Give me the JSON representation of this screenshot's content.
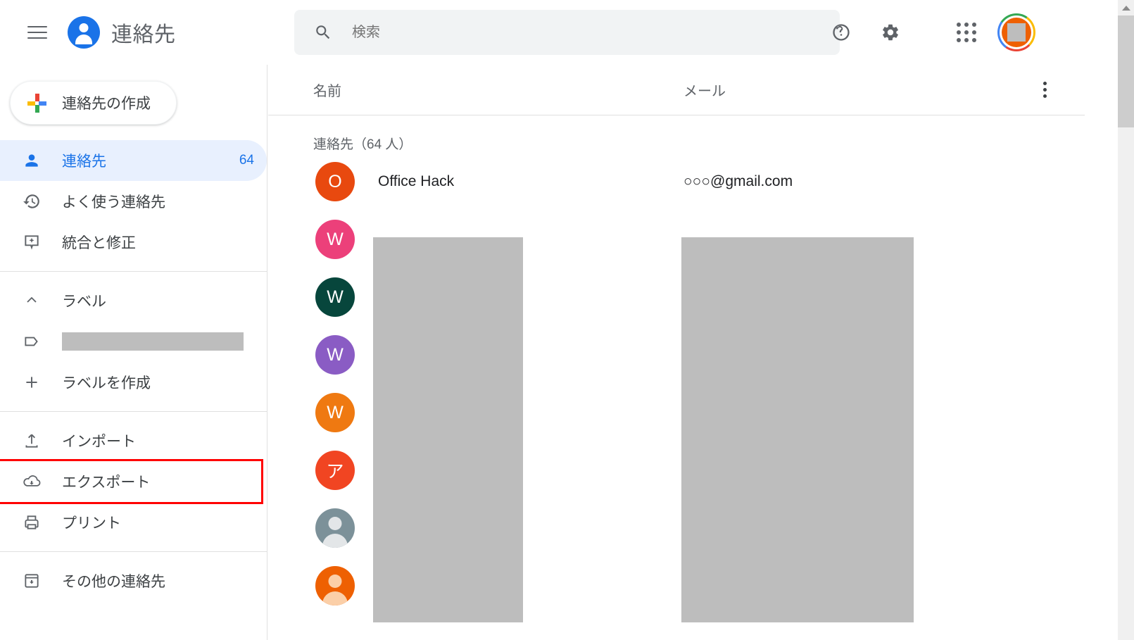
{
  "app": {
    "title": "連絡先",
    "logo_color": "#1a73e8"
  },
  "topbar": {
    "menu_icon": "hamburger-icon",
    "help_icon": "help-icon",
    "settings_icon": "gear-icon",
    "apps_icon": "apps-grid-icon",
    "account_icon": "avatar"
  },
  "search": {
    "placeholder": "検索",
    "value": "",
    "icon": "search-icon"
  },
  "sidebar": {
    "create_button": {
      "label": "連絡先の作成",
      "icon": "plus-icon"
    },
    "primary_items": [
      {
        "label": "連絡先",
        "count": "64",
        "icon": "person-icon",
        "active": true
      },
      {
        "label": "よく使う連絡先",
        "count": "",
        "icon": "history-icon",
        "active": false
      },
      {
        "label": "統合と修正",
        "count": "",
        "icon": "merge-fix-icon",
        "active": false
      }
    ],
    "labels_section": {
      "header": "ラベル",
      "header_icon": "chevron-up-icon",
      "label_item": {
        "label": "",
        "icon": "label-tag-icon",
        "redacted": true
      },
      "create_label": {
        "label": "ラベルを作成",
        "icon": "plus-icon"
      }
    },
    "tools_items": [
      {
        "label": "インポート",
        "icon": "import-icon",
        "highlighted": false
      },
      {
        "label": "エクスポート",
        "icon": "export-icon",
        "highlighted": true
      },
      {
        "label": "プリント",
        "icon": "print-icon",
        "highlighted": false
      }
    ],
    "other_items": [
      {
        "label": "その他の連絡先",
        "icon": "other-contacts-icon"
      }
    ],
    "highlight_color": "#ff0000"
  },
  "main": {
    "columns": {
      "name": "名前",
      "email": "メール"
    },
    "more_menu_icon": "more-vert-icon",
    "group_title": "連絡先（64 人）",
    "contacts": [
      {
        "name": "Office Hack",
        "email": "○○○@gmail.com",
        "initial": "O",
        "avatar_color": "#e8490f",
        "avatar_type": "initial"
      },
      {
        "name": "",
        "email": "",
        "initial": "W",
        "avatar_color": "#ec407a",
        "avatar_type": "initial"
      },
      {
        "name": "",
        "email": "",
        "initial": "W",
        "avatar_color": "#07463c",
        "avatar_type": "initial"
      },
      {
        "name": "",
        "email": "",
        "initial": "W",
        "avatar_color": "#8a5cc4",
        "avatar_type": "initial"
      },
      {
        "name": "",
        "email": "",
        "initial": "W",
        "avatar_color": "#ef7911",
        "avatar_type": "initial"
      },
      {
        "name": "",
        "email": "",
        "initial": "ア",
        "avatar_color": "#f14522",
        "avatar_type": "initial"
      },
      {
        "name": "",
        "email": "",
        "initial": "",
        "avatar_color": "#7c9199",
        "avatar_type": "photo-gray"
      },
      {
        "name": "",
        "email": "",
        "initial": "",
        "avatar_color": "#ee6002",
        "avatar_type": "photo-orange"
      }
    ]
  },
  "scrollbar": {
    "up_arrow_icon": "chevron-up-icon",
    "thumb": "scrollbar-thumb"
  }
}
